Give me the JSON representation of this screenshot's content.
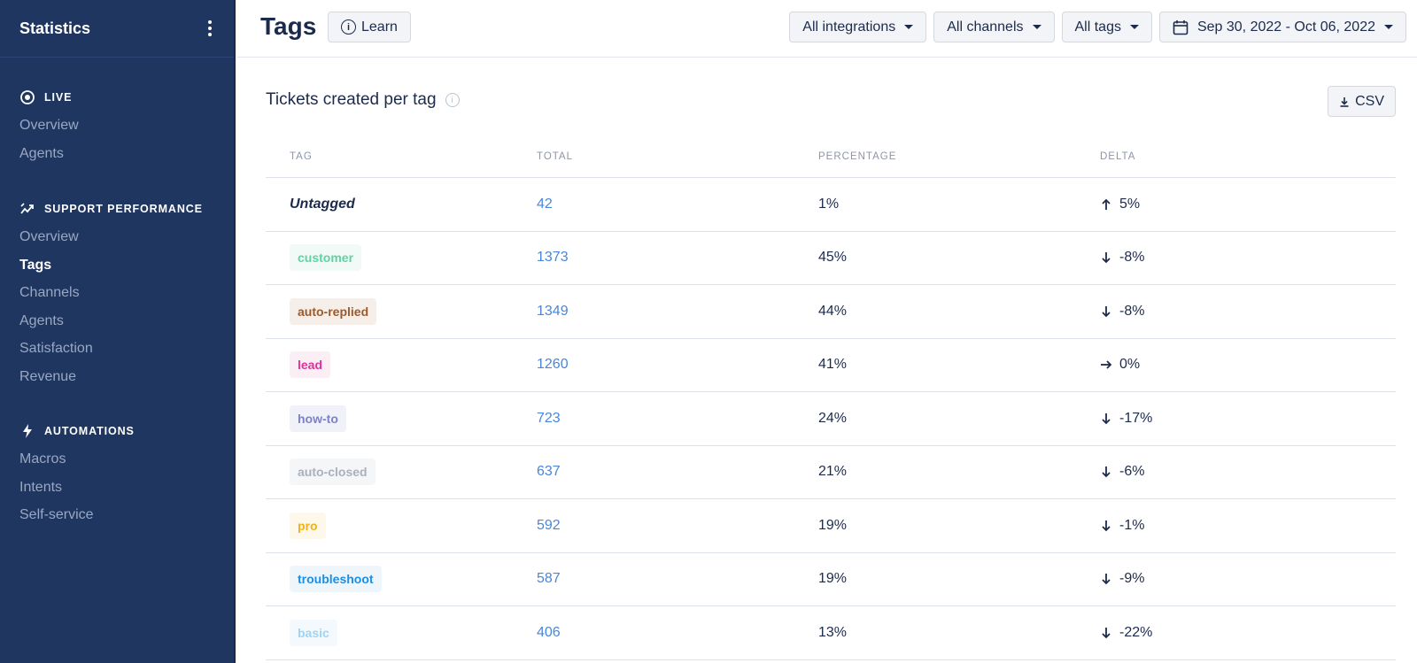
{
  "sidebar": {
    "title": "Statistics",
    "sections": [
      {
        "title": "LIVE",
        "icon": "live-icon",
        "items": [
          "Overview",
          "Agents"
        ]
      },
      {
        "title": "SUPPORT PERFORMANCE",
        "icon": "trend-icon",
        "items": [
          "Overview",
          "Tags",
          "Channels",
          "Agents",
          "Satisfaction",
          "Revenue"
        ]
      },
      {
        "title": "AUTOMATIONS",
        "icon": "bolt-icon",
        "items": [
          "Macros",
          "Intents",
          "Self-service"
        ]
      }
    ],
    "active_item": "Tags"
  },
  "header": {
    "title": "Tags",
    "learn_label": "Learn",
    "filters": {
      "integrations": "All integrations",
      "channels": "All channels",
      "tags": "All tags",
      "date_range": "Sep 30, 2022 - Oct 06, 2022"
    }
  },
  "card": {
    "title": "Tickets created per tag",
    "csv_label": "CSV",
    "columns": [
      "TAG",
      "TOTAL",
      "PERCENTAGE",
      "DELTA"
    ],
    "rows": [
      {
        "tag": "Untagged",
        "total": "42",
        "percentage": "1%",
        "delta": "5%",
        "direction": "up",
        "tag_color": "",
        "tag_bg": ""
      },
      {
        "tag": "customer",
        "total": "1373",
        "percentage": "45%",
        "delta": "-8%",
        "direction": "down",
        "tag_color": "#5fd4a3",
        "tag_bg": "#f1faf6"
      },
      {
        "tag": "auto-replied",
        "total": "1349",
        "percentage": "44%",
        "delta": "-8%",
        "direction": "down",
        "tag_color": "#9a5a2c",
        "tag_bg": "#f6efe9"
      },
      {
        "tag": "lead",
        "total": "1260",
        "percentage": "41%",
        "delta": "0%",
        "direction": "flat",
        "tag_color": "#e0309c",
        "tag_bg": "#fbeef5"
      },
      {
        "tag": "how-to",
        "total": "723",
        "percentage": "24%",
        "delta": "-17%",
        "direction": "down",
        "tag_color": "#7b82c9",
        "tag_bg": "#f0f1f9"
      },
      {
        "tag": "auto-closed",
        "total": "637",
        "percentage": "21%",
        "delta": "-6%",
        "direction": "down",
        "tag_color": "#a8b1bd",
        "tag_bg": "#f5f6f8"
      },
      {
        "tag": "pro",
        "total": "592",
        "percentage": "19%",
        "delta": "-1%",
        "direction": "down",
        "tag_color": "#f2b11c",
        "tag_bg": "#fdf8ea"
      },
      {
        "tag": "troubleshoot",
        "total": "587",
        "percentage": "19%",
        "delta": "-9%",
        "direction": "down",
        "tag_color": "#1a8fe3",
        "tag_bg": "#eef6fc"
      },
      {
        "tag": "basic",
        "total": "406",
        "percentage": "13%",
        "delta": "-22%",
        "direction": "down",
        "tag_color": "#9fd4f2",
        "tag_bg": "#f3f9fd"
      }
    ]
  }
}
